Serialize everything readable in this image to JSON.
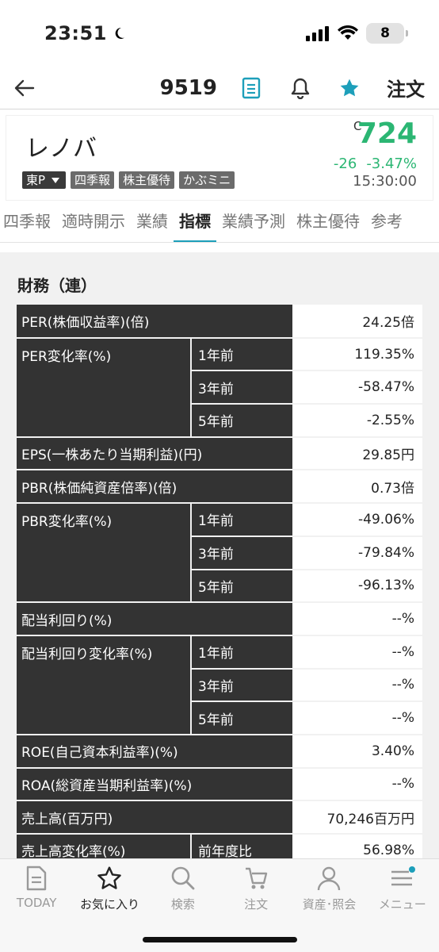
{
  "status": {
    "time": "23:51",
    "battery": "8"
  },
  "nav": {
    "code": "9519",
    "order": "注文"
  },
  "stock": {
    "name": "レノバ",
    "market": "東P",
    "tags": [
      "四季報",
      "株主優待",
      "かぶミニ"
    ],
    "price_type": "C",
    "price": "724",
    "change": "-26",
    "change_pct": "-3.47%",
    "time": "15:30:00"
  },
  "tabs": [
    "四季報",
    "適時開示",
    "業績",
    "指標",
    "業績予測",
    "株主優待",
    "参考"
  ],
  "section_title": "財務（連）",
  "rows": {
    "per": {
      "label": "PER(株価収益率)(倍)",
      "value": "24.25倍"
    },
    "per_chg": {
      "label": "PER変化率(%)",
      "r1": {
        "sub": "1年前",
        "value": "119.35%"
      },
      "r3": {
        "sub": "3年前",
        "value": "-58.47%"
      },
      "r5": {
        "sub": "5年前",
        "value": "-2.55%"
      }
    },
    "eps": {
      "label": "EPS(一株あたり当期利益)(円)",
      "value": "29.85円"
    },
    "pbr": {
      "label": "PBR(株価純資産倍率)(倍)",
      "value": "0.73倍"
    },
    "pbr_chg": {
      "label": "PBR変化率(%)",
      "r1": {
        "sub": "1年前",
        "value": "-49.06%"
      },
      "r3": {
        "sub": "3年前",
        "value": "-79.84%"
      },
      "r5": {
        "sub": "5年前",
        "value": "-96.13%"
      }
    },
    "div": {
      "label": "配当利回り(%)",
      "value": "--%"
    },
    "div_chg": {
      "label": "配当利回り変化率(%)",
      "r1": {
        "sub": "1年前",
        "value": "--%"
      },
      "r3": {
        "sub": "3年前",
        "value": "--%"
      },
      "r5": {
        "sub": "5年前",
        "value": "--%"
      }
    },
    "roe": {
      "label": "ROE(自己資本利益率)(%)",
      "value": "3.40%"
    },
    "roa": {
      "label": "ROA(総資産当期利益率)(%)",
      "value": "--%"
    },
    "sales": {
      "label": "売上高(百万円)",
      "value": "70,246百万円"
    },
    "sales_chg": {
      "label": "売上高変化率(%)",
      "sub": "前年度比",
      "value": "56.98%"
    }
  },
  "bottom_nav": {
    "today": "TODAY",
    "fav": "お気に入り",
    "search": "検索",
    "order": "注文",
    "assets": "資産･照会",
    "menu": "メニュー"
  },
  "colors": {
    "up_down": "#2bb673",
    "accent": "#1d9fba",
    "label_bg": "#333333"
  }
}
